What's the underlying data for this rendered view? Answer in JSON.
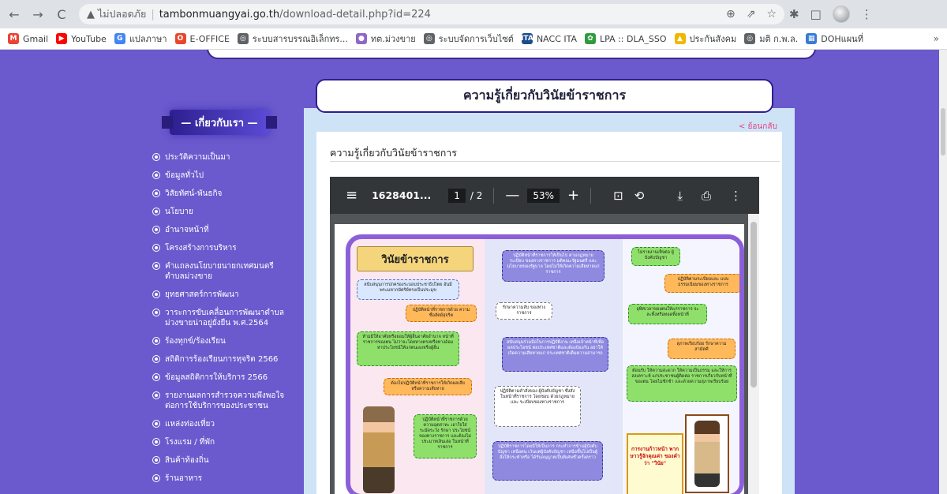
{
  "browser": {
    "not_secure": "ไม่ปลอดภัย",
    "url_host": "tambonmuangyai.go.th",
    "url_path": "/download-detail.php?id=224",
    "back_icon": "←",
    "forward_icon": "→",
    "reload_icon": "C",
    "warning_icon": "▲",
    "zoom_icon": "⊕",
    "share_icon": "⇗",
    "star_icon": "☆",
    "puzzle_icon": "✱",
    "sidepanel_icon": "□",
    "menu_icon": "⋮"
  },
  "bookmarks": [
    {
      "label": "Gmail",
      "icon": "M",
      "color": "#ea4335"
    },
    {
      "label": "YouTube",
      "icon": "▶",
      "color": "#ff0000"
    },
    {
      "label": "แปลภาษา",
      "icon": "G",
      "color": "#4285f4"
    },
    {
      "label": "E-OFFICE",
      "icon": "O",
      "color": "#e8472d"
    },
    {
      "label": "ระบบสารบรรณอิเล็กทร...",
      "icon": "◎",
      "color": "#5f6368"
    },
    {
      "label": "ทต.ม่วงขาย",
      "icon": "●",
      "color": "#8e67c7"
    },
    {
      "label": "ระบบจัดการเว็บไซต์",
      "icon": "◎",
      "color": "#5f6368"
    },
    {
      "label": "NACC ITA",
      "icon": "ITA",
      "color": "#1a4d8c"
    },
    {
      "label": "LPA :: DLA_SSO",
      "icon": "✿",
      "color": "#2e9b3e"
    },
    {
      "label": "ประกันสังคม",
      "icon": "▲",
      "color": "#f2b600"
    },
    {
      "label": "มติ ก.พ.ล.",
      "icon": "◎",
      "color": "#5f6368"
    },
    {
      "label": "DOHแผนที่",
      "icon": "▦",
      "color": "#3a7bd5"
    }
  ],
  "bookmarks_more": "»",
  "sidebar": {
    "header": "— เกี่ยวกับเรา —",
    "items": [
      "ประวัติความเป็นมา",
      "ข้อมูลทั่วไป",
      "วิสัยทัศน์-พันธกิจ",
      "นโยบาย",
      "อำนาจหน้าที่",
      "โครงสร้างการบริหาร",
      "คำแถลงนโยบายนายกเทศมนตรีตำบลม่วงขาย",
      "ยุทธศาสตร์การพัฒนา",
      "วาระการขับเคลื่อนการพัฒนาตำบลม่วงขายน่าอยู่ยั่งยืน พ.ศ.2564",
      "ร้องทุกข์/ร้องเรียน",
      "สถิติการร้องเรียนการทุจริต 2566",
      "ข้อมูลสถิติการให้บริการ 2566",
      "รายงานผลการสำรวจความพึงพอใจต่อการใช้บริการของประชาชน",
      "แหล่งท่องเที่ยว",
      "โรงแรม / ที่พัก",
      "สินค้าท้องถิ่น",
      "ร้านอาหาร"
    ]
  },
  "main": {
    "title": "ความรู้เกี่ยวกับวินัยข้าราชการ",
    "back_link": "< ย้อนกลับ",
    "doc_title": "ความรู้เกี่ยวกับวินัยข้าราชการ"
  },
  "pdf": {
    "filename": "1628401...",
    "current_page": "1",
    "page_total": "/ 2",
    "zoom": "53%",
    "menu_icon": "≡",
    "minus_icon": "—",
    "plus_icon": "+",
    "fit_icon": "⊡",
    "rotate_icon": "⟲",
    "download_icon": "⤓",
    "print_icon": "⎙",
    "more_icon": "⋮"
  },
  "infographic": {
    "banner": "วินัยข้าราชการ",
    "callout": "การงานก้าวหน้า พากษาวรู้จักคุณค่า ของคำว่า \"วินัย\"",
    "bubbles": [
      "สนับสนุนการปกครองระบอบประชาธิปไตย อันมีพระมหากษัตริย์ทรงเป็นประมุข",
      "ปฏิบัติหน้าที่ราชการด้วย ความซื่อสัตย์สุจริต",
      "ห้ามมิให้อาศัยหรือยอมให้ผู้อื่นอาศัยอำนาจ หน้าที่ราชการของตน ไม่ว่าจะโดยทางตรงหรือทางอ้อม หาประโยชน์ให้แก่ตนเองหรือผู้อื่น",
      "ต้องไม่ปฏิบัติหน้าที่ราชการให้เกิดผลเสีย หรือความเสียหาย",
      "ปฏิบัติหน้าที่ราชการด้วย ความอุตสาหะ เอาใจใส่ ระมัดระวัง รักษา ประโยชน์ของทางราชการ และต้องไม่ประมาทเลินเล่อ ในหน้าที่ราชการ",
      "ปฏิบัติหน้าที่ราชการให้เป็นไป ตามกฎหมาย ระเบียบ ของทางราชการ มติคณะรัฐมนตรี และนโยบายของรัฐบาล โดยไม่ให้เกิดความเสียหายแก่ราชการ",
      "รักษาความลับ ของทางราชการ",
      "สนับสนุนร่วมมือในการปฏิบัติงาน เหนือเจ้าหน้าที่เพื่อผลประโยชน์ ต่อประเทศชาติและต้องป้องกัน อย่าให้เกิดความเสียหายแก่ ประเทศชาติเต็มความสามารถ",
      "ปฏิบัติตามคำสั่งของ ผู้บังคับบัญชา ซึ่งสั่งในหน้าที่ราชการ โดยชอบ ด้วยกฎหมายและ ระเบียบของทางราชการ",
      "ปฏิบัติราชการโดยมิให้เป็นการ กระทำการข้ามผู้บังคับบัญชา เหนือตน เว้นแต่ผู้บังคับบัญชา เหนือขึ้นไปเป็นผู้สั่งให้กระทำหรือ ได้รับอนุญาตเป็นพิเศษชั่วครั้งคราว",
      "ไม่รายงานเท็จต่อ ผู้บังคับบัญชา",
      "ปฏิบัติตามระเบียบและ แบบธรรมเนียมของทางราชการ",
      "อุทิศเวลาของตนให้แก่ราชการ จะละทิ้งหรือทอดทิ้งหน้าที่",
      "สุภาพเรียบร้อย รักษาความสามัคคี",
      "ต้อนรับ ให้ความสะดวก ให้ความเป็นธรรม และให้การสงเคราะห์ แก่ประชาชนผู้ติดต่อ ราชการเกี่ยวกับหน้าที่ของตน โดยไม่ชักช้า และด้วยความสุภาพเรียบร้อย"
    ]
  }
}
